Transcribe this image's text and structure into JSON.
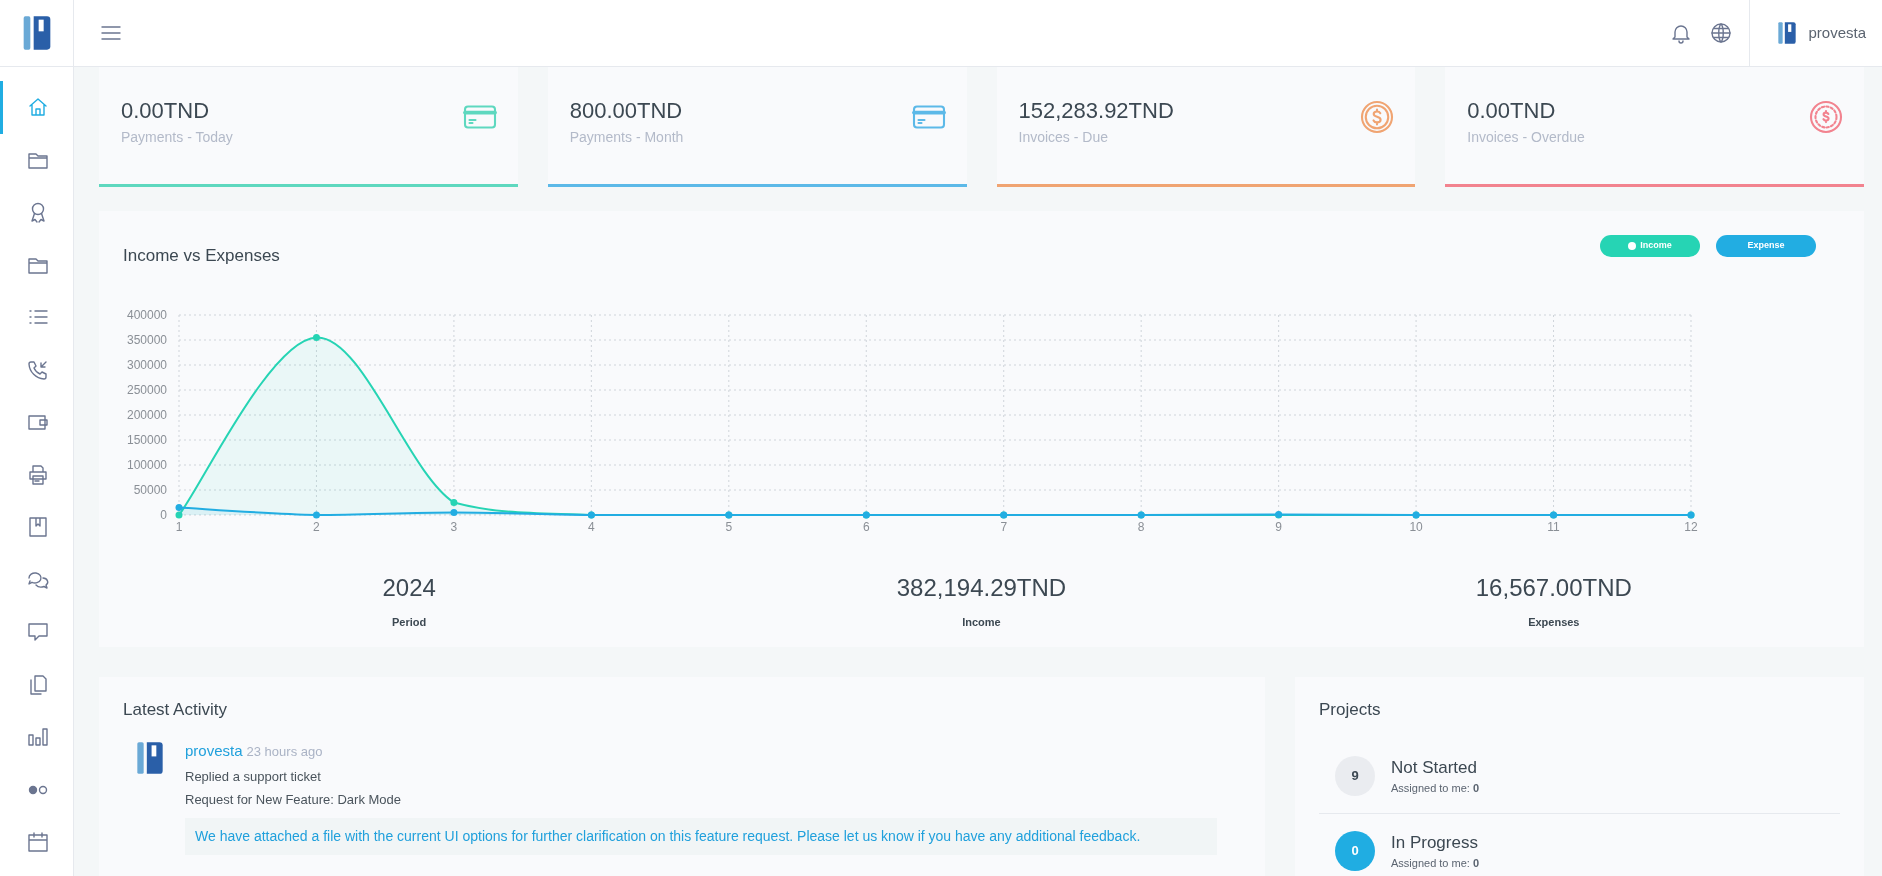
{
  "header": {
    "user_name": "provesta"
  },
  "sidebar": {
    "items": [
      {
        "selected": true
      },
      {
        "selected": false
      },
      {
        "selected": false
      },
      {
        "selected": false
      },
      {
        "selected": false
      },
      {
        "selected": false
      },
      {
        "selected": false
      },
      {
        "selected": false
      },
      {
        "selected": false
      },
      {
        "selected": false
      },
      {
        "selected": false
      },
      {
        "selected": false
      },
      {
        "selected": false
      },
      {
        "selected": false
      },
      {
        "selected": false
      }
    ]
  },
  "stat_cards": [
    {
      "value": "0.00TND",
      "label": "Payments - Today",
      "kind": "card",
      "color": "#5ed8bf"
    },
    {
      "value": "800.00TND",
      "label": "Payments - Month",
      "kind": "card",
      "color": "#5cb9e8"
    },
    {
      "value": "152,283.92TND",
      "label": "Invoices - Due",
      "kind": "coin",
      "color": "#f0a472"
    },
    {
      "value": "0.00TND",
      "label": "Invoices - Overdue",
      "kind": "coin-dashed",
      "color": "#f2838f"
    }
  ],
  "income_chart": {
    "title": "Income vs Expenses",
    "legend": [
      {
        "marker": true
      },
      {
        "marker": false
      }
    ],
    "chart_data": {
      "type": "area",
      "grid": true,
      "categories": [
        "1",
        "2",
        "3",
        "4",
        "5",
        "6",
        "7",
        "8",
        "9",
        "10",
        "11",
        "12"
      ],
      "ylim": [
        0,
        400000
      ],
      "yticks": [
        0,
        50000,
        100000,
        150000,
        200000,
        250000,
        300000,
        350000,
        400000
      ],
      "series": [
        {
          "name": "Income",
          "color": "#26d4b4",
          "values": [
            0,
            355000,
            25000,
            0,
            0,
            0,
            0,
            0,
            0,
            0,
            0,
            0
          ]
        },
        {
          "name": "Expense",
          "color": "#22ade2",
          "values": [
            15000,
            0,
            5000,
            0,
            0,
            0,
            0,
            0,
            1000,
            0,
            0,
            0
          ]
        }
      ]
    },
    "summary": [
      {
        "value": "2024",
        "label": "Period"
      },
      {
        "value": "382,194.29TND",
        "label": "Income"
      },
      {
        "value": "16,567.00TND",
        "label": "Expenses"
      }
    ]
  },
  "latest_activity": {
    "title": "Latest Activity",
    "entries": [
      {
        "user": "provesta",
        "time": "23 hours ago",
        "action": "Replied a support ticket",
        "subject": "Request for New Feature: Dark Mode",
        "message": "We have attached a file with the current UI options for further clarification on this feature request. Please let us know if you have any additional feedback."
      }
    ]
  },
  "projects": {
    "title": "Projects",
    "items": [
      {
        "count": "9",
        "label": "Not Started",
        "assigned": "Assigned to me: **0**",
        "color": "#eaecf0"
      },
      {
        "count": "0",
        "label": "In Progress",
        "assigned": "Assigned to me: **0**",
        "color": "#20ade2"
      }
    ]
  }
}
